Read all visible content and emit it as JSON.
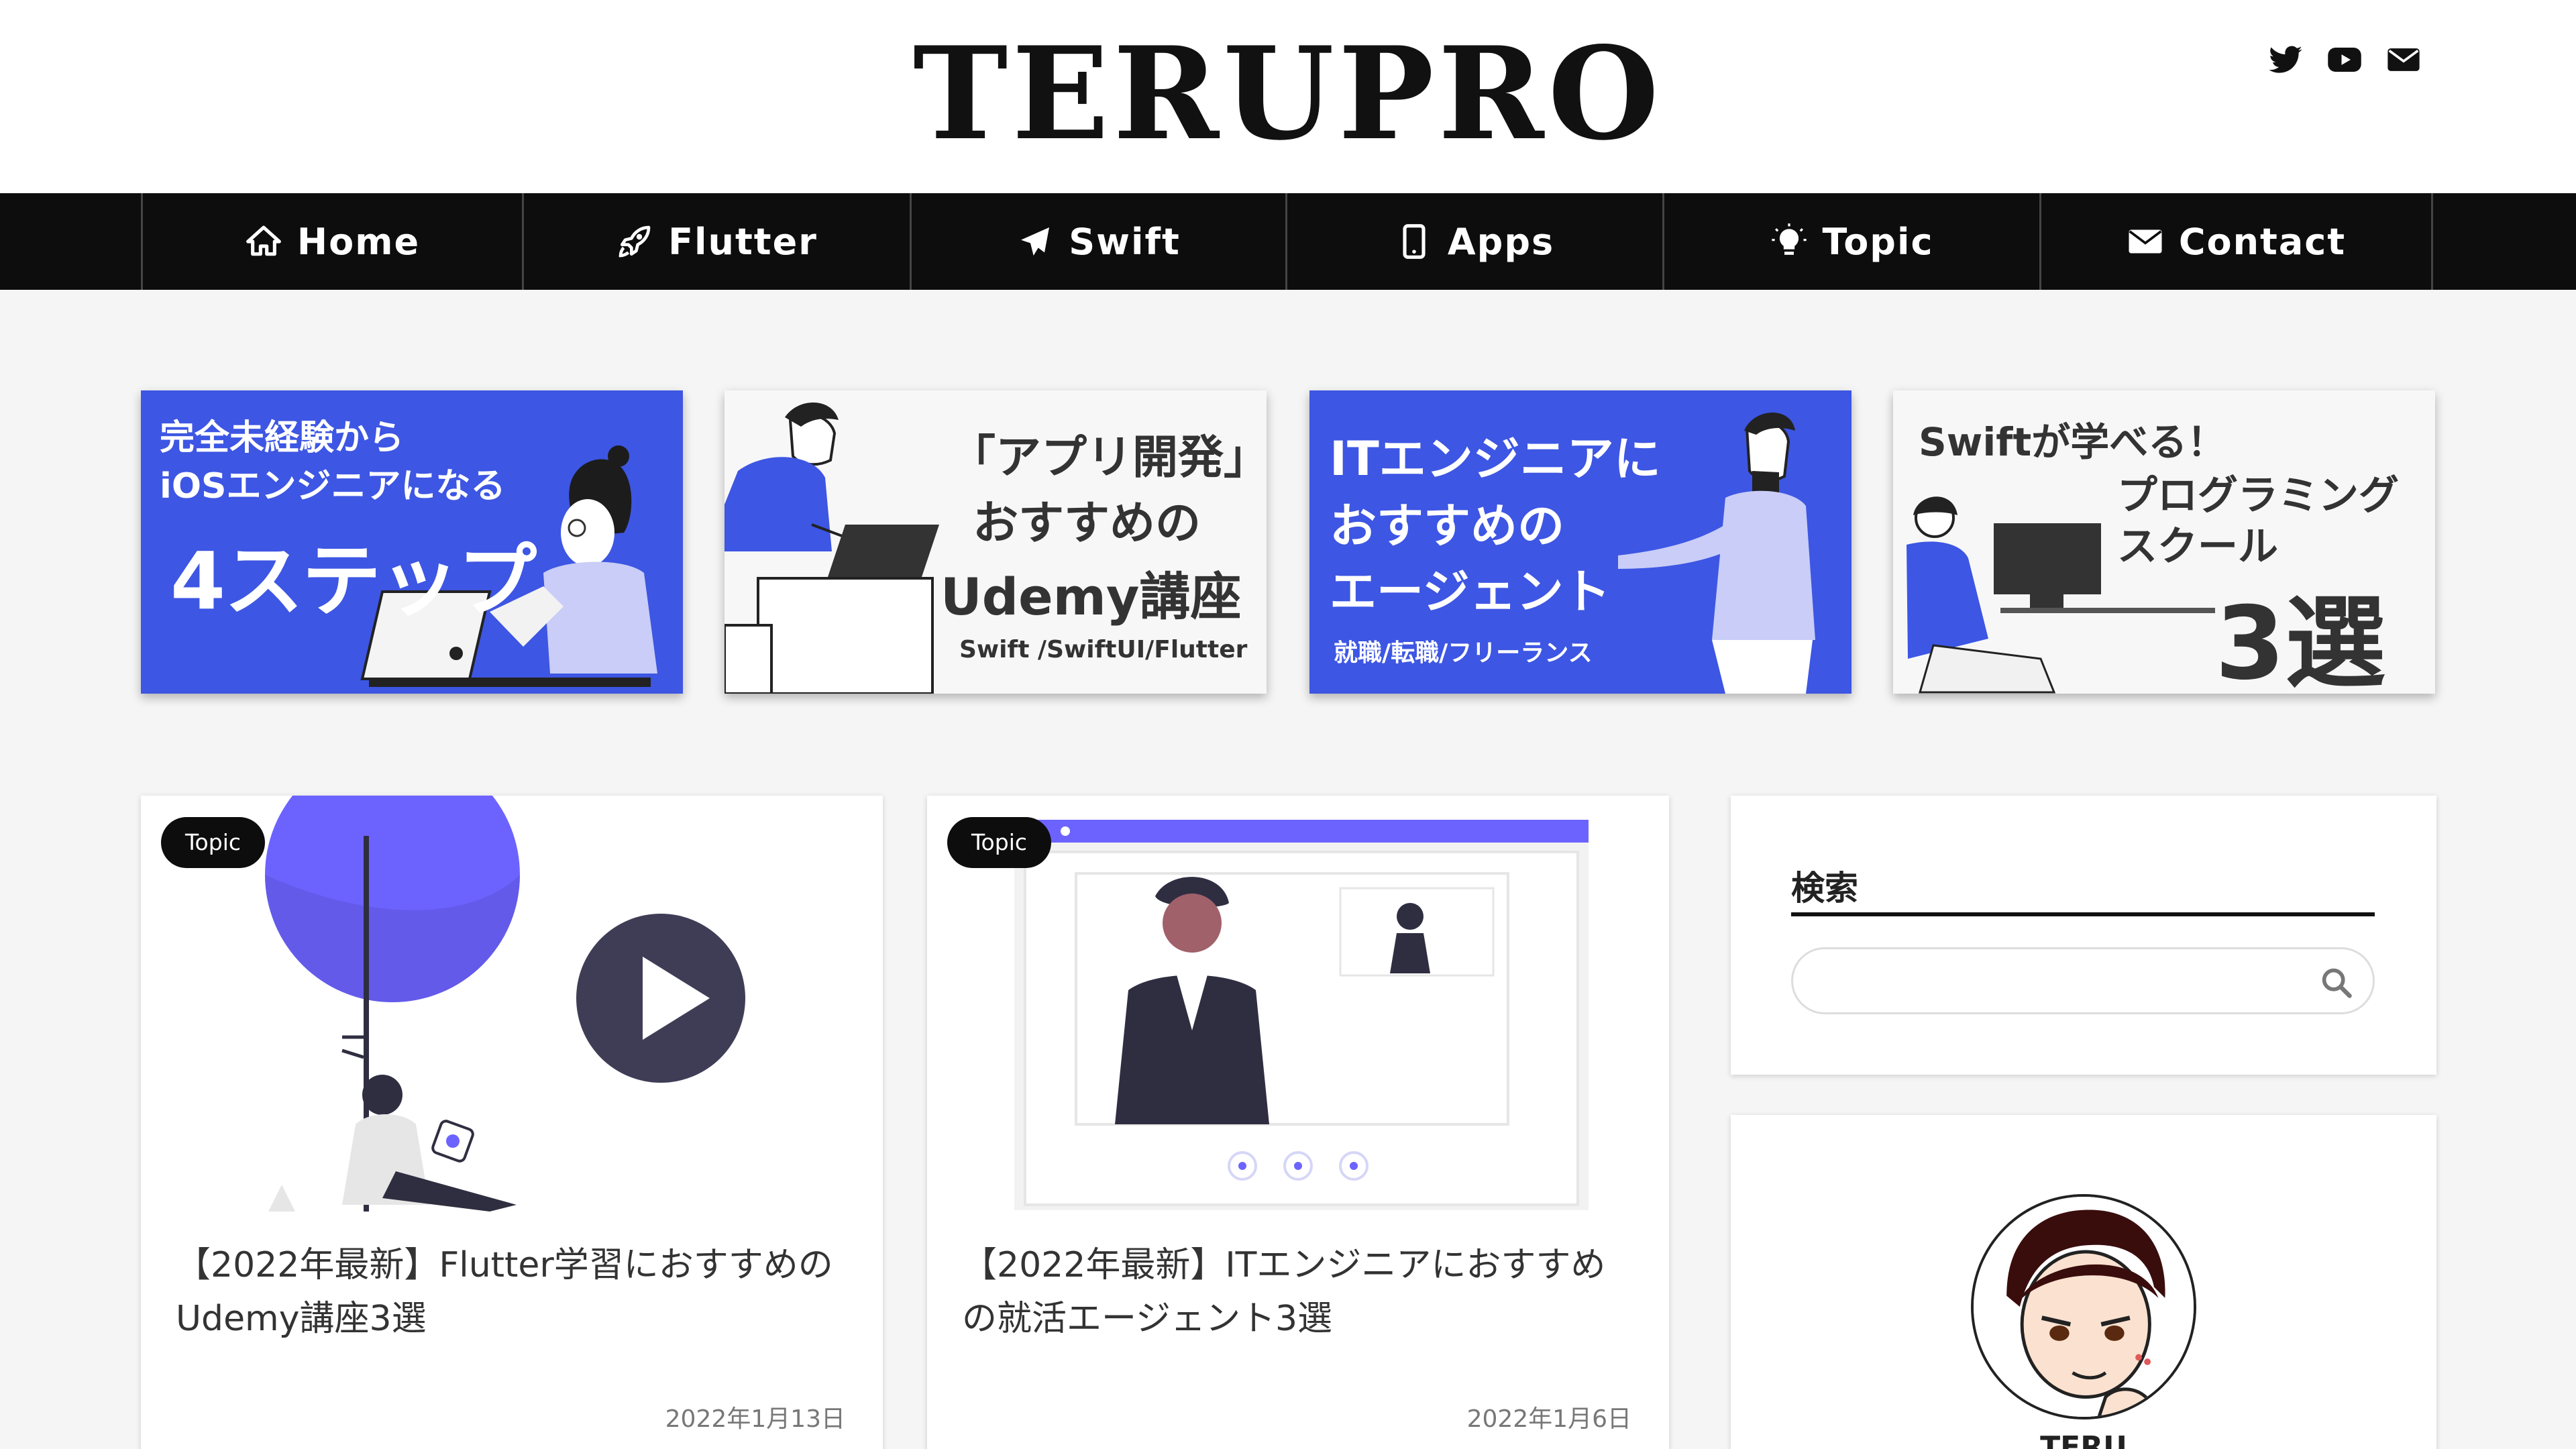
{
  "site": {
    "title": "TERUPRO"
  },
  "social": [
    "twitter-icon",
    "youtube-icon",
    "mail-icon"
  ],
  "nav": [
    {
      "label": "Home",
      "icon": "home-icon"
    },
    {
      "label": "Flutter",
      "icon": "rocket-icon"
    },
    {
      "label": "Swift",
      "icon": "plane-icon"
    },
    {
      "label": "Apps",
      "icon": "phone-icon"
    },
    {
      "label": "Topic",
      "icon": "lightbulb-icon"
    },
    {
      "label": "Contact",
      "icon": "envelope-icon"
    }
  ],
  "banners": [
    {
      "line1": "完全未経験から",
      "line2": "iOSエンジニアになる",
      "big": "4ステップ"
    },
    {
      "line1": "「アプリ開発」",
      "line2": "おすすめの",
      "line3": "Udemy講座",
      "sub": "Swift /SwiftUI/Flutter"
    },
    {
      "line1": "ITエンジニアに",
      "line2": "おすすめの",
      "line3": "エージェント",
      "sub": "就職/転職/フリーランス"
    },
    {
      "line1": "Swiftが学べる！",
      "line2": "プログラミング",
      "line3": "スクール",
      "big": "3選"
    }
  ],
  "posts": [
    {
      "category": "Topic",
      "title": "【2022年最新】Flutter学習におすすめのUdemy講座3選",
      "date": "2022年1月13日"
    },
    {
      "category": "Topic",
      "title": "【2022年最新】ITエンジニアにおすすめの就活エージェント3選",
      "date": "2022年1月6日"
    }
  ],
  "sidebar": {
    "search_title": "検索",
    "search_placeholder": "",
    "profile_name": "TERU"
  },
  "colors": {
    "accent": "#3d56e3",
    "nav_bg": "#0d0d0d",
    "illustration": "#6c63ff"
  }
}
